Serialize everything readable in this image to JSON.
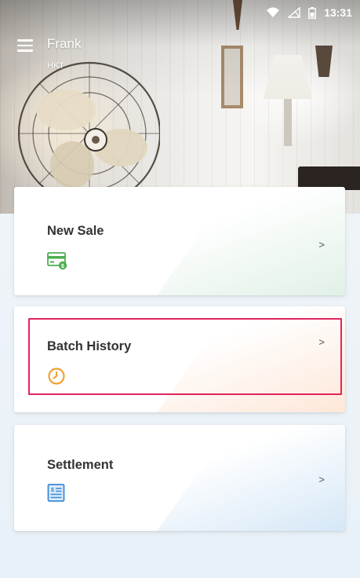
{
  "status_bar": {
    "time": "13:31",
    "icons": [
      "wifi-icon",
      "signal-icon",
      "battery-icon"
    ]
  },
  "header": {
    "menu_icon": "menu-icon",
    "user_name": "Frank",
    "user_sub": "HKT"
  },
  "cards": [
    {
      "label": "New Sale",
      "icon": "card-payment-icon",
      "arrow": ">",
      "accent": "#4caf50"
    },
    {
      "label": "Batch History",
      "icon": "clock-icon",
      "arrow": ">",
      "accent": "#f0a030"
    },
    {
      "label": "Settlement",
      "icon": "receipt-dollar-icon",
      "arrow": ">",
      "accent": "#3a8ad6"
    }
  ],
  "highlight": {
    "target": "Batch History",
    "color": "#e0245e"
  }
}
